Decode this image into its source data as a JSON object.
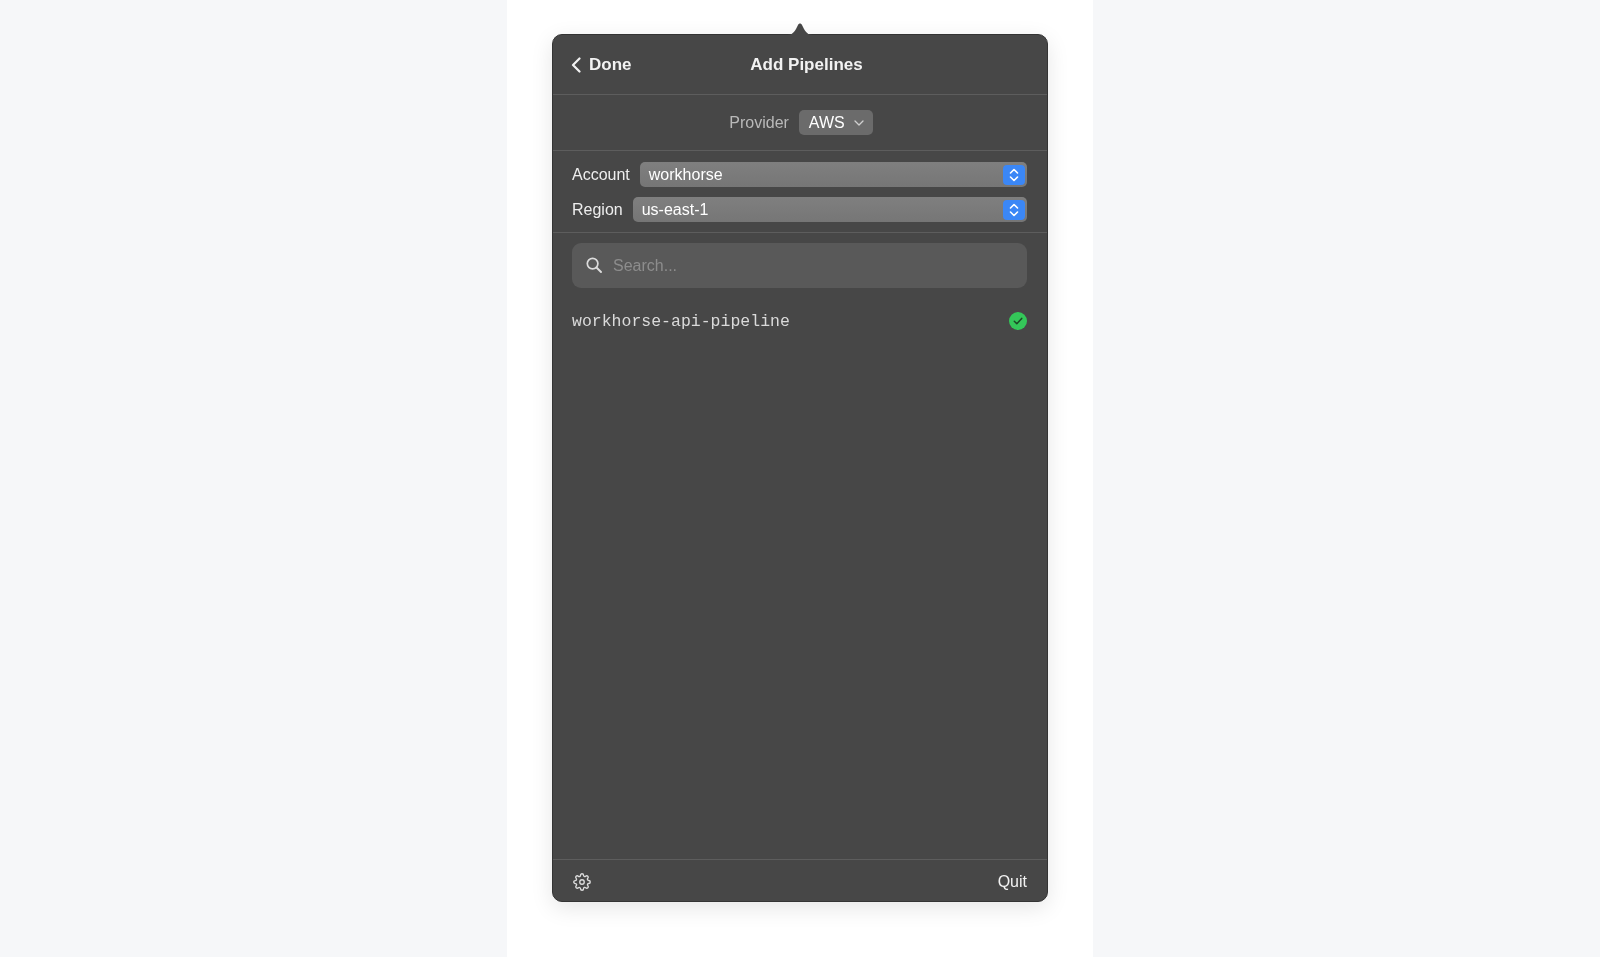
{
  "header": {
    "back_button": "Done",
    "title": "Add Pipelines"
  },
  "provider": {
    "label": "Provider",
    "value": "AWS"
  },
  "selectors": [
    {
      "label": "Account",
      "value": "workhorse"
    },
    {
      "label": "Region",
      "value": "us-east-1"
    }
  ],
  "search": {
    "placeholder": "Search..."
  },
  "pipelines": [
    {
      "name": "workhorse-api-pipeline",
      "added": true
    }
  ],
  "footer": {
    "quit_button": "Quit"
  }
}
